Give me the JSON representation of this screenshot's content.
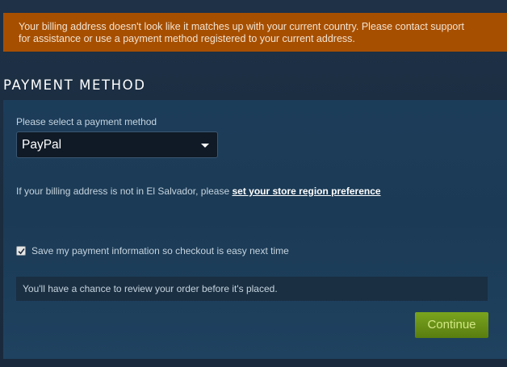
{
  "warning": {
    "line1": "Your billing address doesn't look like it matches up with your current country. Please contact support",
    "line2": "for assistance or use a payment method registered to your current address."
  },
  "payment": {
    "section_title": "PAYMENT METHOD",
    "select_label": "Please select a payment method",
    "selected_method": "PayPal",
    "region_text": "If your billing address is not in El Salvador, please ",
    "region_link": "set your store region preference",
    "save_label": "Save my payment information so checkout is easy next time",
    "save_checked": true,
    "review_note": "You'll have a chance to review your order before it's placed.",
    "continue_label": "Continue"
  },
  "colors": {
    "warning_bg": "#a74f00",
    "continue_bg": "#6b9116",
    "continue_text": "#d2e885"
  },
  "icons": {
    "dropdown": "chevron-down-icon",
    "checkbox": "checkmark-icon"
  }
}
